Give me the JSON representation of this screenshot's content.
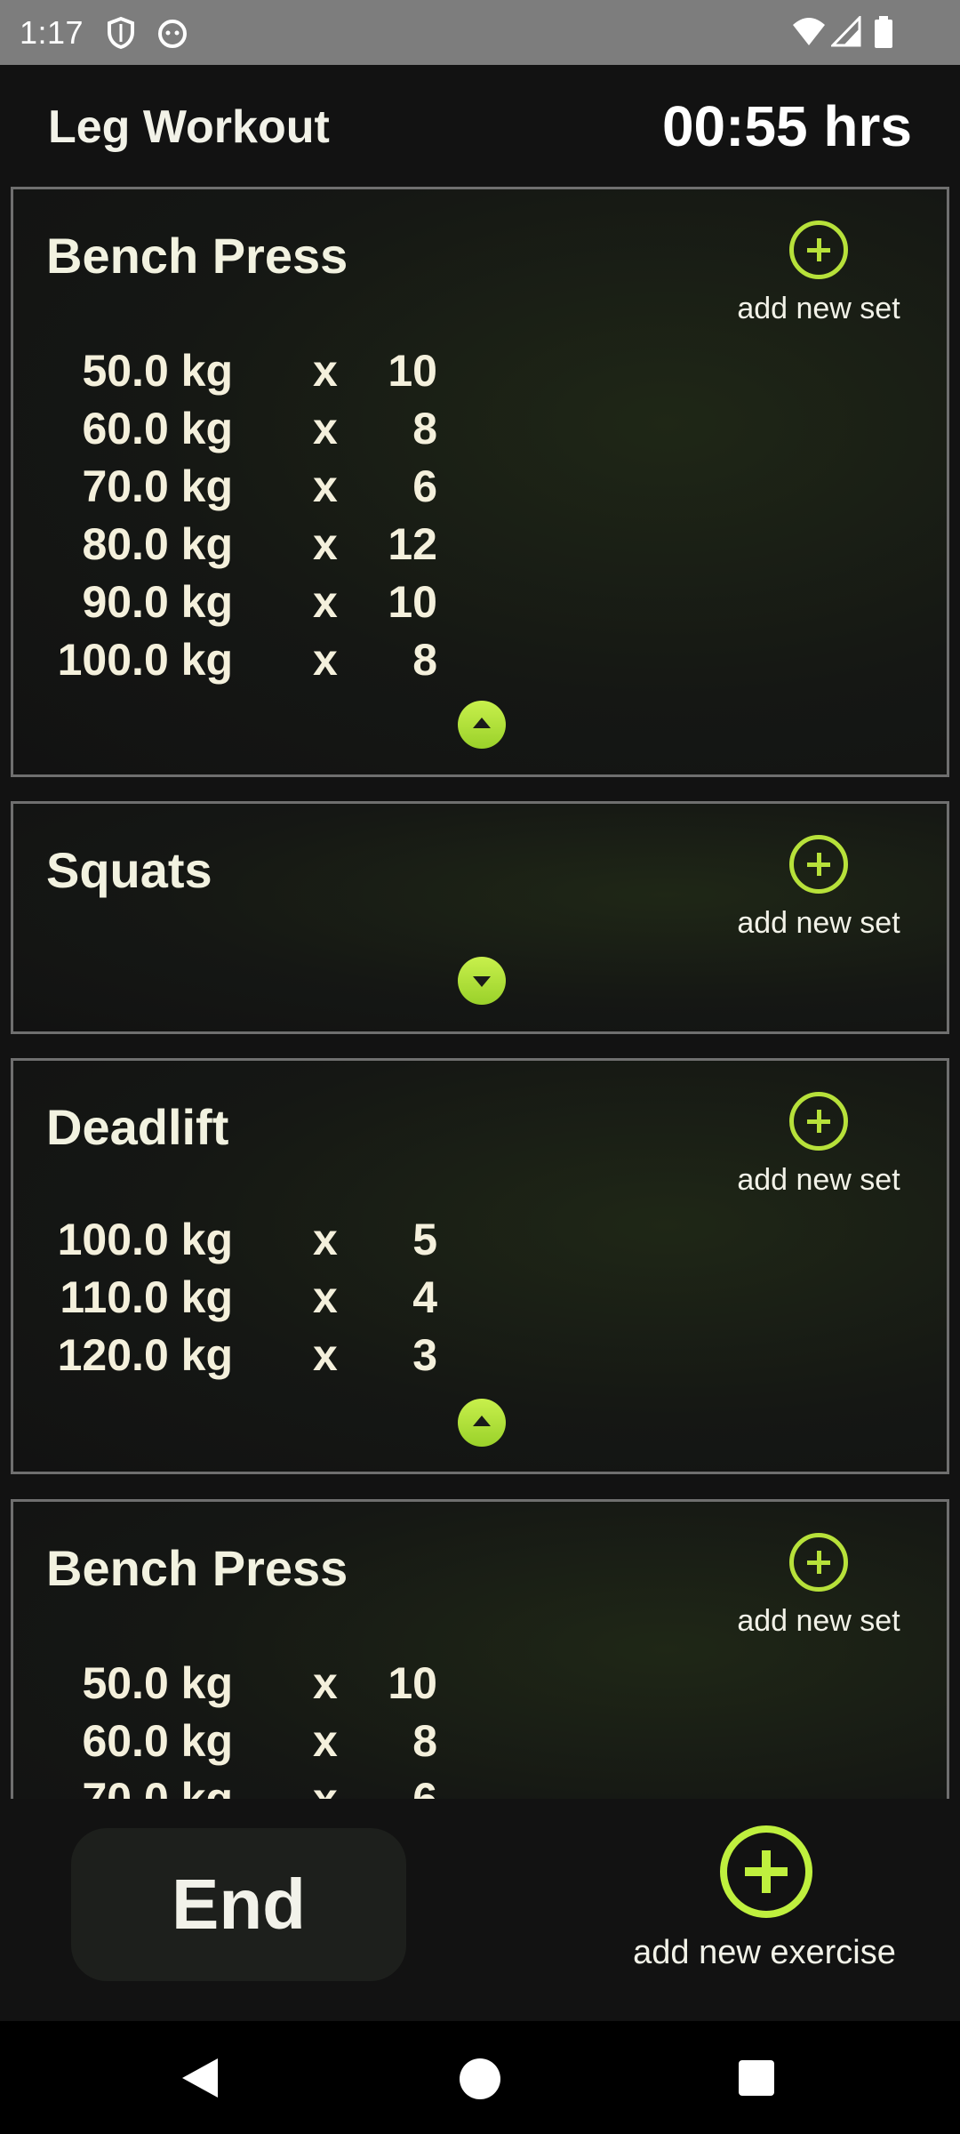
{
  "status_bar": {
    "time": "1:17",
    "icons": [
      "shield-icon",
      "cat-face-icon",
      "wifi-icon",
      "signal-icon",
      "battery-icon"
    ]
  },
  "header": {
    "title": "Leg Workout",
    "timer": "00:55 hrs"
  },
  "add_set_label": "add new set",
  "exercises": [
    {
      "name": "Bench Press",
      "expanded": true,
      "sets": [
        {
          "weight": "50.0 kg",
          "x": "x",
          "reps": "10"
        },
        {
          "weight": "60.0 kg",
          "x": "x",
          "reps": "8"
        },
        {
          "weight": "70.0 kg",
          "x": "x",
          "reps": "6"
        },
        {
          "weight": "80.0 kg",
          "x": "x",
          "reps": "12"
        },
        {
          "weight": "90.0 kg",
          "x": "x",
          "reps": "10"
        },
        {
          "weight": "100.0 kg",
          "x": "x",
          "reps": "8"
        }
      ]
    },
    {
      "name": "Squats",
      "expanded": false,
      "sets": []
    },
    {
      "name": "Deadlift",
      "expanded": true,
      "sets": [
        {
          "weight": "100.0 kg",
          "x": "x",
          "reps": "5"
        },
        {
          "weight": "110.0 kg",
          "x": "x",
          "reps": "4"
        },
        {
          "weight": "120.0 kg",
          "x": "x",
          "reps": "3"
        }
      ]
    },
    {
      "name": "Bench Press",
      "expanded": true,
      "sets": [
        {
          "weight": "50.0 kg",
          "x": "x",
          "reps": "10"
        },
        {
          "weight": "60.0 kg",
          "x": "x",
          "reps": "8"
        },
        {
          "weight": "70.0 kg",
          "x": "x",
          "reps": "6"
        }
      ]
    }
  ],
  "bottom": {
    "end_label": "End",
    "add_exercise_label": "add new exercise"
  },
  "colors": {
    "accent": "#b7e13a",
    "background": "#121212",
    "card_border": "#6f6f6f"
  }
}
